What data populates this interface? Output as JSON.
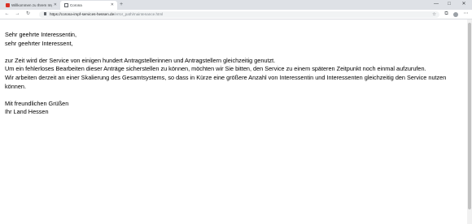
{
  "browser": {
    "tabs": [
      {
        "title": "Willkommen zu Ihrem Impfterm",
        "icon": "red-square-icon",
        "active": false
      },
      {
        "title": "Coronа",
        "icon": "document-icon",
        "active": true
      }
    ],
    "new_tab_symbol": "+",
    "window_controls": {
      "minimize": "—",
      "maximize": "□",
      "close": "✕"
    },
    "url_host": "https://corona-impf-services-hessen.de",
    "url_path": "/error_path/maintenance.html"
  },
  "message": {
    "greeting_1": "Sehr geehrte Interessentin,",
    "greeting_2": "sehr geehrter Interessent,",
    "line_1": "zur Zeit wird der Service von einigen hundert Antragstellerinnen und Antragstellern gleichzeitig genutzt.",
    "line_2": "Um ein fehlerloses Bearbeiten dieser Anträge sicherstellen zu können, möchten wir Sie bitten, den Service zu einem späteren Zeitpunkt noch einmal aufzurufen.",
    "line_3": "Wir arbeiten derzeit an einer Skalierung des Gesamtsystems, so dass in Kürze eine größere Anzahl von Interessentin und Interessenten gleichzeitig den Service nutzen können.",
    "closing_1": "Mit freundlichen Grüßen",
    "closing_2": "Ihr Land Hessen"
  }
}
